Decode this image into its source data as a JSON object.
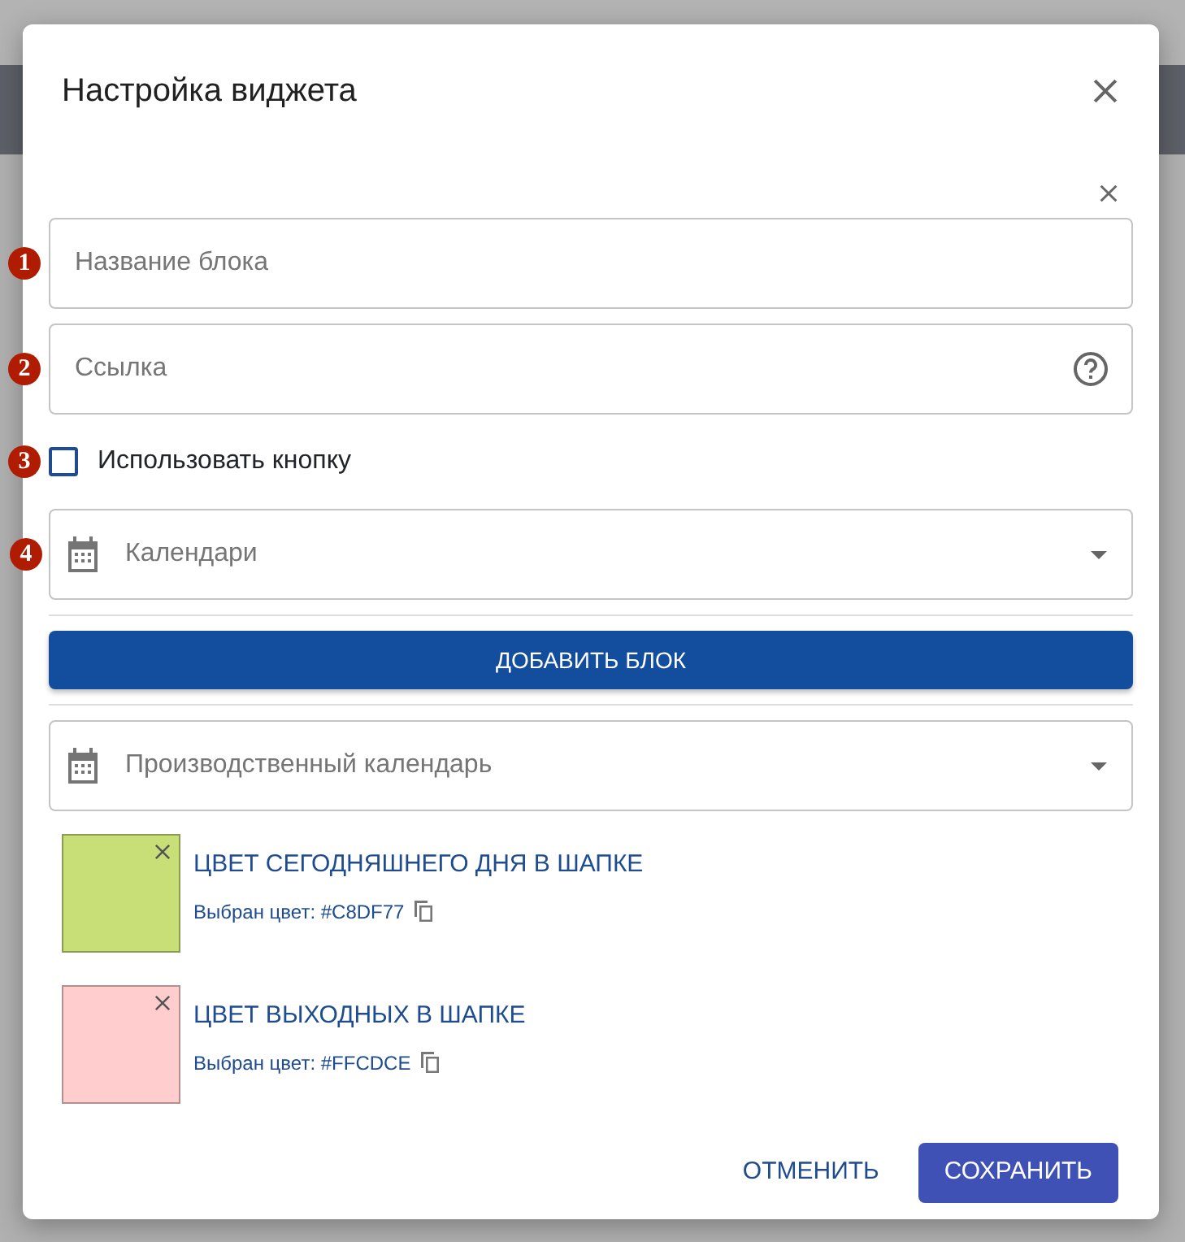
{
  "dialog": {
    "title": "Настройка виджета"
  },
  "fields": [
    {
      "kind": "text",
      "marker": "1",
      "placeholder": "Название блока"
    },
    {
      "kind": "link",
      "marker": "2",
      "placeholder": "Ссылка"
    },
    {
      "kind": "checkbox",
      "marker": "3",
      "label": "Использовать кнопку",
      "checked": false
    },
    {
      "kind": "select",
      "marker": "4",
      "placeholder": "Календари"
    }
  ],
  "add_button": "ДОБАВИТЬ БЛОК",
  "production_calendar": {
    "placeholder": "Производственный календарь"
  },
  "colors": [
    {
      "title": "ЦВЕТ СЕГОДНЯШНЕГО ДНЯ В ШАПКЕ",
      "caption": "Выбран цвет: #C8DF77",
      "color": "#c8df77"
    },
    {
      "title": "ЦВЕТ ВЫХОДНЫХ В ШАПКЕ",
      "caption": "Выбран цвет: #FFCDCE",
      "color": "#ffcdce"
    }
  ],
  "buttons": [
    {
      "label": "ОТМЕНИТЬ",
      "kind": "text"
    },
    {
      "label": "СОХРАНИТЬ",
      "kind": "primary"
    }
  ]
}
